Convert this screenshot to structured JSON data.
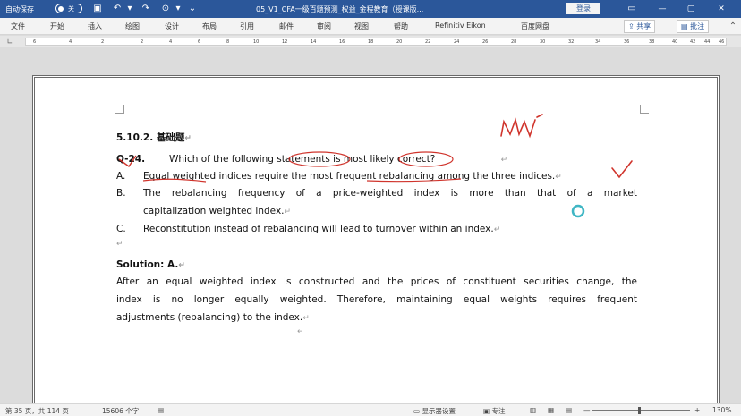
{
  "titlebar": {
    "autosave_label": "自动保存",
    "autosave_state": "关",
    "doc_title": "05_V1_CFA一级百题预测_权益_金程教育（授课版...",
    "login_label": "登录",
    "minimize": "—",
    "restore": "▢",
    "close": "✕"
  },
  "ribbon": {
    "tabs": [
      "文件",
      "开始",
      "插入",
      "绘图",
      "设计",
      "布局",
      "引用",
      "邮件",
      "审阅",
      "视图",
      "帮助",
      "Refinitiv Eikon",
      "百度网盘"
    ],
    "share_label": "共享",
    "comment_label": "批注"
  },
  "ruler": {
    "ticks": [
      "6",
      "4",
      "2",
      "2",
      "4",
      "6",
      "8",
      "10",
      "12",
      "14",
      "16",
      "18",
      "20",
      "22",
      "24",
      "26",
      "28",
      "30",
      "32",
      "34",
      "36",
      "38",
      "40",
      "42",
      "44",
      "46"
    ]
  },
  "document": {
    "heading": "5.10.2.  基础题",
    "question_num": "Q-24.",
    "question_text": "Which of the following statements is most likely correct?",
    "options": [
      {
        "letter": "A.",
        "text": "Equal weighted indices require the most frequent rebalancing among the three indices."
      },
      {
        "letter": "B.",
        "text": "The rebalancing frequency of a price-weighted index is more than that of a market",
        "text2": "capitalization weighted index."
      },
      {
        "letter": "C.",
        "text": "Reconstitution instead of rebalancing will lead to turnover within an index."
      }
    ],
    "solution_label": "Solution: A.",
    "solution_lines": [
      "After an equal weighted index is constructed and the prices of constituent securities change, the",
      "index is no longer equally weighted. Therefore, maintaining equal weights requires frequent",
      "adjustments (rebalancing) to the index."
    ],
    "para_mark": "↵",
    "annotation": "MV"
  },
  "status": {
    "page": "第 35 页，共 114 页",
    "words": "15606 个字",
    "display": "显示器设置",
    "focus": "专注",
    "zoom": "130%",
    "zoom_minus": "—",
    "zoom_plus": "+"
  }
}
